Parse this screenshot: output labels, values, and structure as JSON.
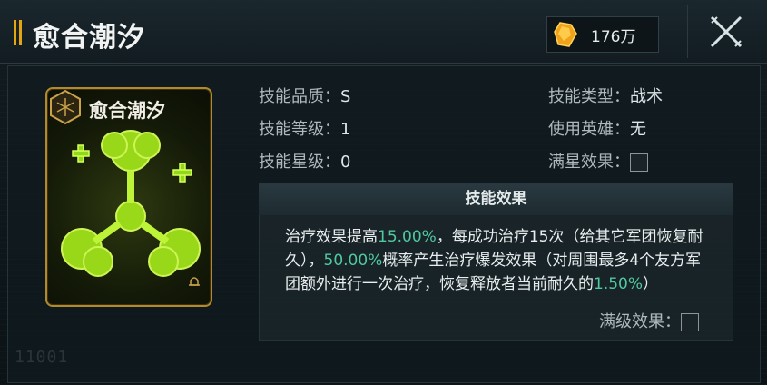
{
  "header": {
    "title": "愈合潮汐",
    "currency_value": "176万",
    "currency_icon": "crystal-icon",
    "close_icon": "close-icon"
  },
  "card": {
    "title": "愈合潮汐",
    "emblem_icon": "hex-emblem-icon",
    "lock_icon": "bell-icon"
  },
  "info": {
    "quality_label": "技能品质：",
    "quality_value": "S",
    "level_label": "技能等级：",
    "level_value": "1",
    "star_label": "技能星级：",
    "star_value": "0",
    "type_label": "技能类型：",
    "type_value": "战术",
    "hero_label": "使用英雄：",
    "hero_value": "无",
    "fullstar_label": "满星效果："
  },
  "effect": {
    "heading": "技能效果",
    "p1": "治疗效果提高",
    "v1": "15.00%",
    "p2": "，每成功治疗15次（给其它军团恢复耐久），",
    "v2": "50.00%",
    "p3": "概率产生治疗爆发效果（对周围最多4个友方军团额外进行一次治疗，恢复释放者当前耐久的",
    "v3": "1.50%",
    "p4": "）",
    "maxlevel_label": "满级效果："
  },
  "watermark": "11001",
  "colors": {
    "accent": "#e3a514",
    "highlight": "#4fc9a0",
    "card_border": "#b18a2b"
  }
}
